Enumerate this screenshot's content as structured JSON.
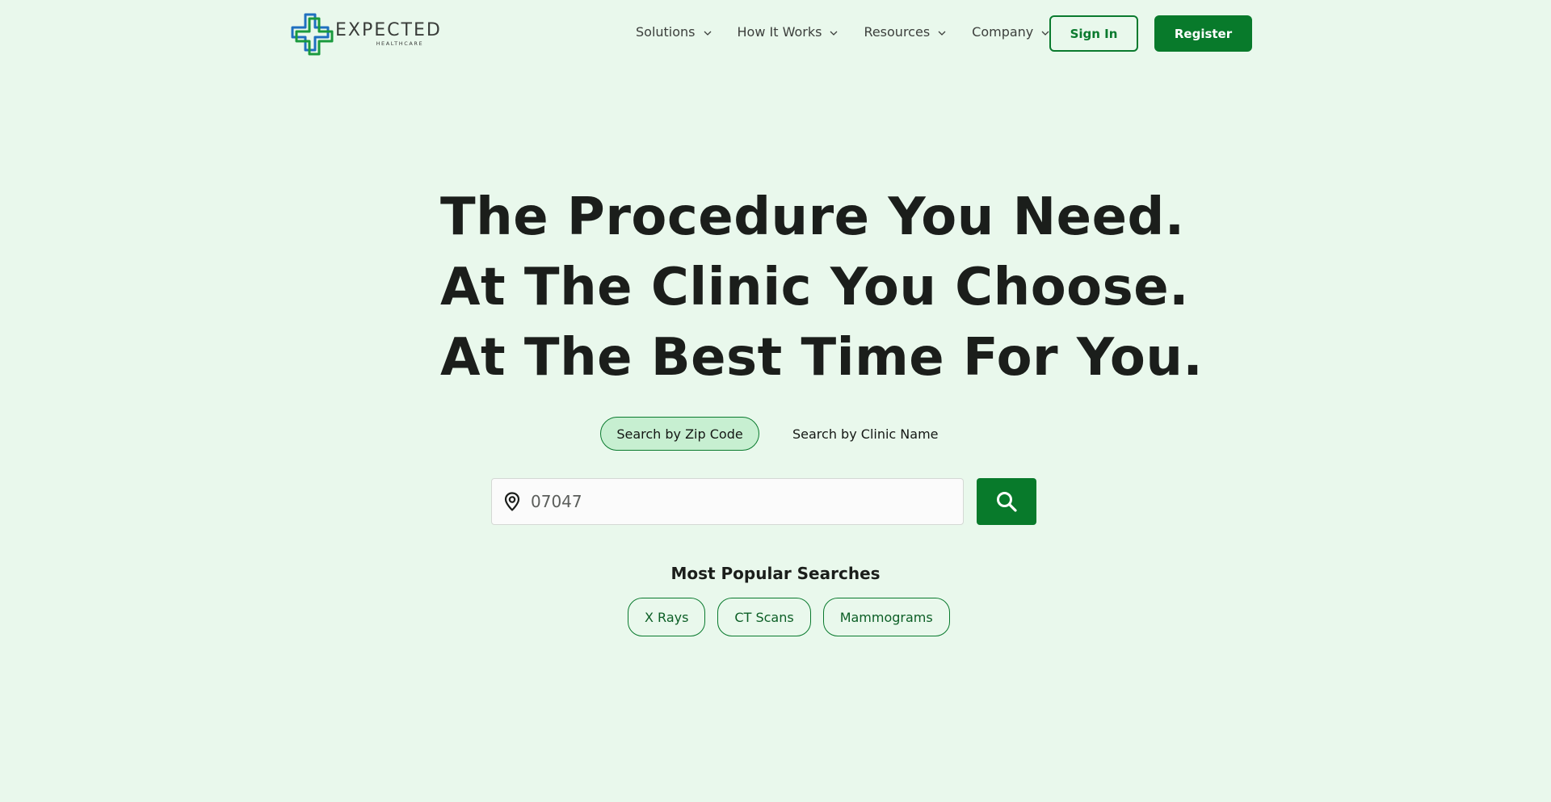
{
  "brand": {
    "name": "EXPECTED",
    "subname": "HEALTHCARE",
    "colors": {
      "primary": "#087a2b",
      "background": "#e9f8ec",
      "active_tab": "#c7efd1",
      "logo_blue": "#1f6fc0"
    }
  },
  "nav": {
    "items": [
      {
        "label": "Solutions",
        "icon": "chevron-down-icon"
      },
      {
        "label": "How It Works",
        "icon": "chevron-down-icon"
      },
      {
        "label": "Resources",
        "icon": "chevron-down-icon"
      },
      {
        "label": "Company",
        "icon": "chevron-down-icon"
      }
    ],
    "sign_in": "Sign In",
    "register": "Register"
  },
  "hero": {
    "lines": [
      "The Procedure You Need.",
      "At The Clinic You Choose.",
      "At The Best Time For You."
    ]
  },
  "search": {
    "tabs": {
      "active": "Search by Zip Code",
      "inactive": "Search by Clinic Name"
    },
    "input_value": "07047",
    "input_icon": "map-pin-icon",
    "button_icon": "search-icon"
  },
  "popular": {
    "title": "Most Popular Searches",
    "chips": [
      "X Rays",
      "CT Scans",
      "Mammograms"
    ]
  }
}
